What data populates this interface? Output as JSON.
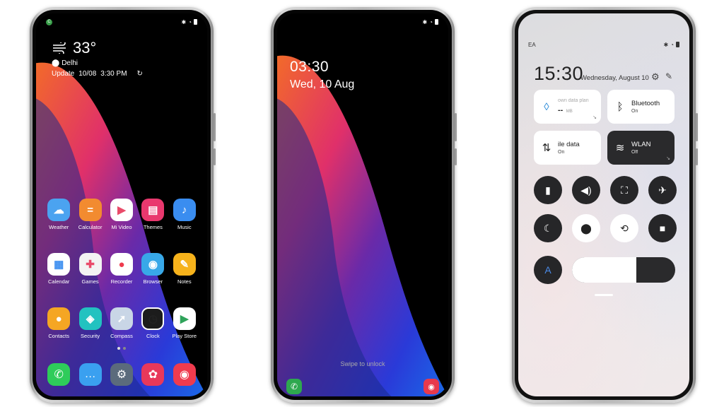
{
  "home": {
    "status": {
      "left_badge": "C",
      "right_icons": [
        "bluetooth-icon",
        "alarm-icon",
        "battery-icon"
      ]
    },
    "weather": {
      "temperature": "33°",
      "city": "Delhi",
      "update_label": "Update",
      "update_date": "10/08",
      "update_time": "3:30 PM"
    },
    "apps": [
      {
        "label": "Weather",
        "icon": "weather-icon",
        "color": "#4ba3f0"
      },
      {
        "label": "Calculator",
        "icon": "calculator-icon",
        "color": "#f28b30"
      },
      {
        "label": "Mi Video",
        "icon": "play-icon",
        "color": "#ffffff"
      },
      {
        "label": "Themes",
        "icon": "themes-icon",
        "color": "#e9386e"
      },
      {
        "label": "Music",
        "icon": "music-icon",
        "color": "#3a8df0"
      },
      {
        "label": "Calendar",
        "icon": "calendar-icon",
        "color": "#ffffff"
      },
      {
        "label": "Games",
        "icon": "games-icon",
        "color": "#f3f3f3"
      },
      {
        "label": "Recorder",
        "icon": "recorder-icon",
        "color": "#ffffff"
      },
      {
        "label": "Browser",
        "icon": "browser-icon",
        "color": "#38a8e8"
      },
      {
        "label": "Notes",
        "icon": "notes-icon",
        "color": "#f6b21b"
      },
      {
        "label": "Contacts",
        "icon": "contacts-icon",
        "color": "#f5a623"
      },
      {
        "label": "Security",
        "icon": "security-icon",
        "color": "#22c2c0"
      },
      {
        "label": "Compass",
        "icon": "compass-icon",
        "color": "#c9d6e6"
      },
      {
        "label": "Clock",
        "icon": "clock-icon",
        "color": "#ffffff"
      },
      {
        "label": "Play Store",
        "icon": "play-store-icon",
        "color": "#ffffff"
      }
    ],
    "page_indicator": {
      "pages": 2,
      "current": 1
    },
    "dock": [
      {
        "name": "phone-icon",
        "color": "#2ecc5a"
      },
      {
        "name": "messages-icon",
        "color": "#3aa0f0"
      },
      {
        "name": "settings-icon",
        "color": "#5b6b7c"
      },
      {
        "name": "gallery-icon",
        "color": "#e8385a"
      },
      {
        "name": "camera-icon",
        "color": "#ef3b4e"
      }
    ]
  },
  "lock": {
    "time": "03:30",
    "date": "Wed, 10 Aug",
    "swipe_hint": "Swipe to unlock"
  },
  "control_center": {
    "status_left": "EA",
    "time": "15:30",
    "date": "Wednesday, August 10",
    "tiles": [
      {
        "title": "own data plan",
        "value": "--",
        "unit": "MB",
        "style": "light",
        "icon": "water-drop-icon"
      },
      {
        "title": "Bluetooth",
        "sub": "On",
        "style": "light",
        "icon": "bluetooth-icon"
      },
      {
        "title": "ile data",
        "sub": "On",
        "style": "light",
        "icon": "mobile-data-icon"
      },
      {
        "title": "WLAN",
        "sub": "Off",
        "style": "dark",
        "icon": "wifi-icon"
      }
    ],
    "toggles_row1": [
      {
        "name": "flashlight-toggle",
        "state": "off"
      },
      {
        "name": "sound-toggle",
        "state": "off"
      },
      {
        "name": "screenshot-toggle",
        "state": "off"
      },
      {
        "name": "airplane-toggle",
        "state": "off"
      }
    ],
    "toggles_row2": [
      {
        "name": "dark-mode-toggle",
        "state": "off"
      },
      {
        "name": "location-toggle",
        "state": "on"
      },
      {
        "name": "auto-rotate-toggle",
        "state": "on"
      },
      {
        "name": "screen-record-toggle",
        "state": "off"
      }
    ],
    "auto_brightness_label": "A",
    "brightness_level": 0.62
  }
}
